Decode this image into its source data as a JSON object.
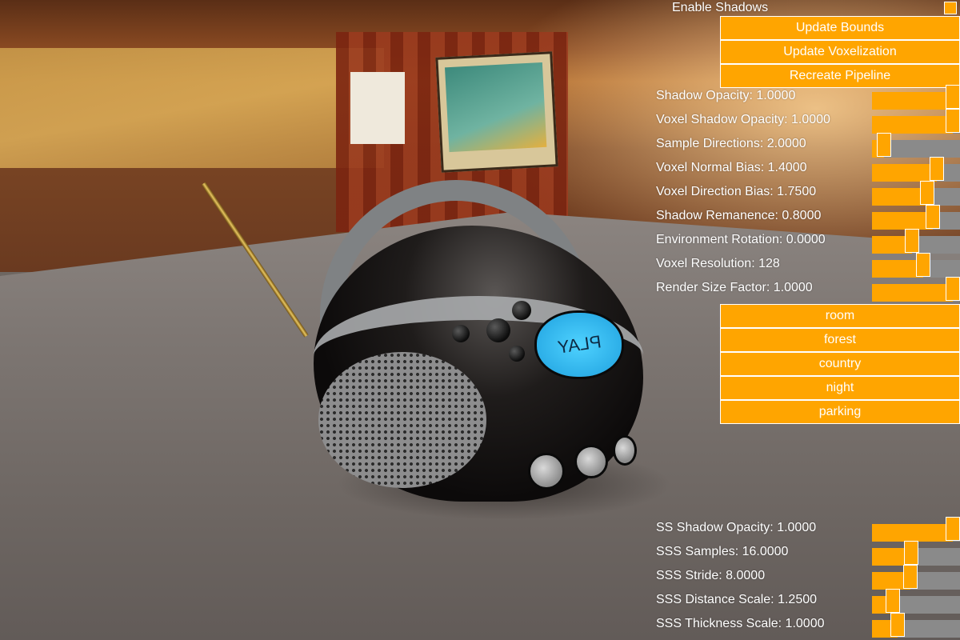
{
  "scene": {
    "play_label": "PLAY"
  },
  "controls": {
    "enable_shadows": {
      "label": "Enable Shadows",
      "checked": true
    },
    "buttons": [
      {
        "label": "Update Bounds"
      },
      {
        "label": "Update Voxelization"
      },
      {
        "label": "Recreate Pipeline"
      }
    ],
    "sliders": [
      {
        "label": "Shadow Opacity: 1.0000",
        "fill_fraction": 1.0
      },
      {
        "label": "Voxel Shadow Opacity: 1.0000",
        "fill_fraction": 1.0
      },
      {
        "label": "Sample Directions: 2.0000",
        "fill_fraction": 0.06
      },
      {
        "label": "Voxel Normal Bias: 1.4000",
        "fill_fraction": 0.78
      },
      {
        "label": "Voxel Direction Bias: 1.7500",
        "fill_fraction": 0.65
      },
      {
        "label": "Shadow Remanence: 0.8000",
        "fill_fraction": 0.73
      },
      {
        "label": "Environment Rotation: 0.0000",
        "fill_fraction": 0.45
      },
      {
        "label": "Voxel Resolution: 128",
        "fill_fraction": 0.6
      },
      {
        "label": "Render Size Factor: 1.0000",
        "fill_fraction": 1.0
      }
    ],
    "environments": [
      {
        "label": "room"
      },
      {
        "label": "forest"
      },
      {
        "label": "country"
      },
      {
        "label": "night"
      },
      {
        "label": "parking"
      }
    ],
    "ss_sliders": [
      {
        "label": "SS Shadow Opacity: 1.0000",
        "fill_fraction": 1.0
      },
      {
        "label": "SSS Samples: 16.0000",
        "fill_fraction": 0.43
      },
      {
        "label": "SSS Stride: 8.0000",
        "fill_fraction": 0.42
      },
      {
        "label": "SSS Distance Scale: 1.2500",
        "fill_fraction": 0.19
      },
      {
        "label": "SSS Thickness Scale: 1.0000",
        "fill_fraction": 0.25
      }
    ],
    "accent_color": "#ffa500",
    "track_color": "#8a8a8a"
  }
}
